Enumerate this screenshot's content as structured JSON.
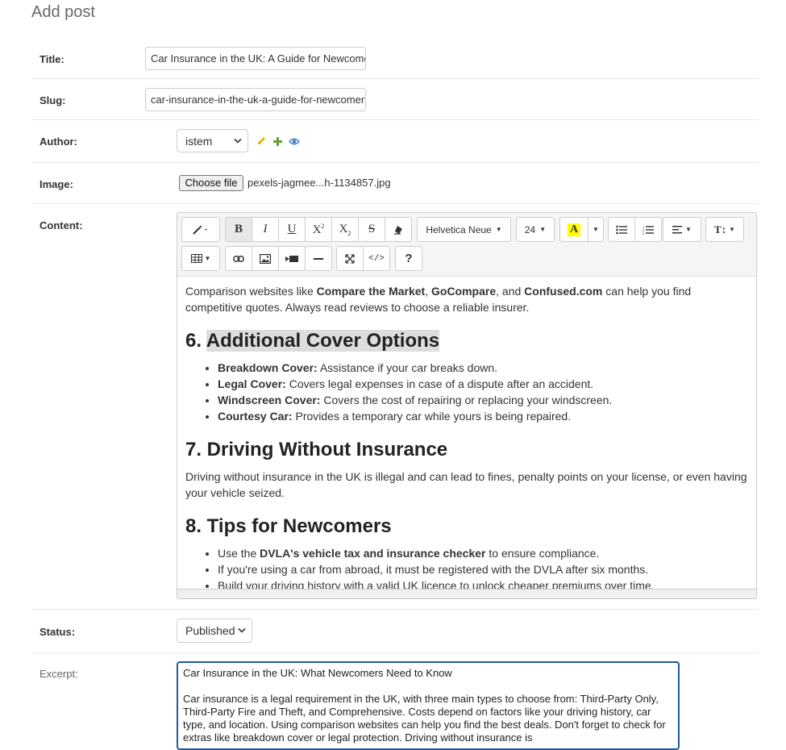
{
  "page_title": "Add post",
  "fields": {
    "title_label": "Title:",
    "title_value": "Car Insurance in the UK: A Guide for Newcomers",
    "slug_label": "Slug:",
    "slug_value": "car-insurance-in-the-uk-a-guide-for-newcomers",
    "author_label": "Author:",
    "author_value": "istem",
    "image_label": "Image:",
    "file_button": "Choose file",
    "file_name": "pexels-jagmee...h-1134857.jpg",
    "content_label": "Content:",
    "status_label": "Status:",
    "status_value": "Published",
    "excerpt_label": "Excerpt:",
    "excerpt_value": "Car Insurance in the UK: What Newcomers Need to Know\n\nCar insurance is a legal requirement in the UK, with three main types to choose from: Third-Party Only, Third-Party Fire and Theft, and Comprehensive. Costs depend on factors like your driving history, car type, and location. Using comparison websites can help you find the best deals. Don't forget to check for extras like breakdown cover or legal protection. Driving without insurance is"
  },
  "toolbar": {
    "font_family": "Helvetica Neue",
    "font_size": "24"
  },
  "content": {
    "p1_a": "Comparison websites like ",
    "p1_b": "Compare the Market",
    "p1_c": ", ",
    "p1_d": "GoCompare",
    "p1_e": ", and ",
    "p1_f": "Confused.com",
    "p1_g": " can help you find competitive quotes. Always read reviews to choose a reliable insurer.",
    "h6_num": "6. ",
    "h6_text": "Additional Cover Options",
    "list1": [
      {
        "b": "Breakdown Cover:",
        "t": " Assistance if your car breaks down."
      },
      {
        "b": "Legal Cover:",
        "t": " Covers legal expenses in case of a dispute after an accident."
      },
      {
        "b": "Windscreen Cover:",
        "t": " Covers the cost of repairing or replacing your windscreen."
      },
      {
        "b": "Courtesy Car:",
        "t": " Provides a temporary car while yours is being repaired."
      }
    ],
    "h7": "7. Driving Without Insurance",
    "p2": "Driving without insurance in the UK is illegal and can lead to fines, penalty points on your license, or even having your vehicle seized.",
    "h8": "8. Tips for Newcomers",
    "tip1_a": "Use the ",
    "tip1_b": "DVLA's vehicle tax and insurance checker",
    "tip1_c": " to ensure compliance.",
    "tip2": "If you're using a car from abroad, it must be registered with the DVLA after six months.",
    "tip3": "Build your driving history with a valid UK licence to unlock cheaper premiums over time."
  },
  "icons": {
    "edit": "pencil-icon",
    "add": "plus-icon",
    "view": "eye-icon"
  },
  "colors": {
    "excerpt_focus": "#205b9e",
    "pencil": "#e0b400",
    "plus": "#5ea532",
    "eye": "#3d7fc2",
    "highlight": "#ffff00"
  }
}
